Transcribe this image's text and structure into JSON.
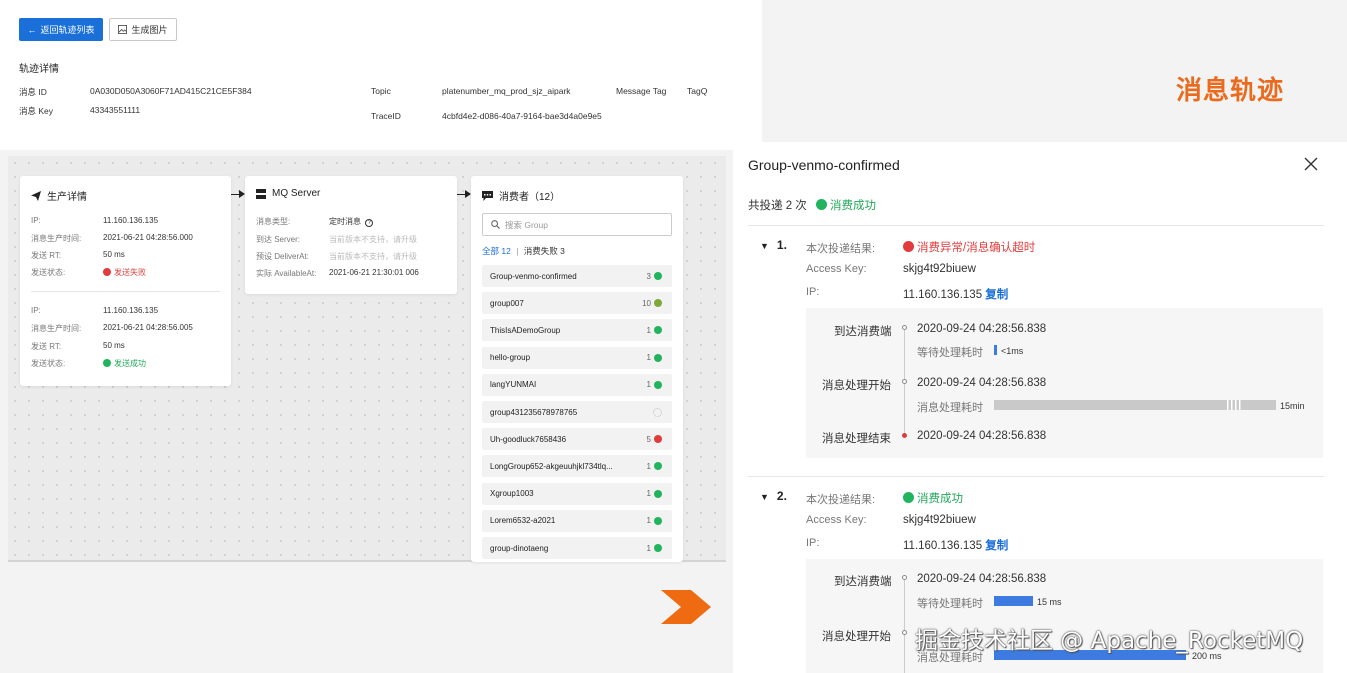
{
  "toolbar": {
    "back_label": "返回轨迹列表",
    "image_label": "生成图片"
  },
  "trace_info": {
    "section_title": "轨迹详情",
    "msg_id_label": "消息 ID",
    "msg_id": "0A030D050A3060F71AD415C21CE5F384",
    "msg_key_label": "消息 Key",
    "msg_key": "43343551111",
    "topic_label": "Topic",
    "topic": "platenumber_mq_prod_sjz_aipark",
    "tag_label": "Message Tag",
    "tag": "TagQ",
    "trace_id_label": "TraceID",
    "trace_id": "4cbfd4e2-d086-40a7-9164-bae3d4a0e9e5"
  },
  "slide_title": "消息轨迹",
  "producer": {
    "title": "生产详情",
    "records": [
      {
        "ip_label": "IP:",
        "ip": "11.160.136.135",
        "time_label": "消息生产时间:",
        "time": "2021-06-21 04:28:56.000",
        "rt_label": "发送 RT:",
        "rt": "50 ms",
        "status_label": "发送状态:",
        "status": "发送失败",
        "status_type": "fail"
      },
      {
        "ip_label": "IP:",
        "ip": "11.160.136.135",
        "time_label": "消息生产时间:",
        "time": "2021-06-21 04:28:56.005",
        "rt_label": "发送 RT:",
        "rt": "50 ms",
        "status_label": "发送状态:",
        "status": "发送成功",
        "status_type": "ok"
      }
    ]
  },
  "server": {
    "title": "MQ Server",
    "type_label": "消息类型:",
    "type": "定时消息",
    "arrive_label": "到达 Server:",
    "arrive": "当前版本不支持，请升级",
    "preset_label": "预设 DeliverAt:",
    "preset": "当前版本不支持，请升级",
    "actual_label": "实际 AvailableAt:",
    "actual": "2021-06-21 21:30:01 006"
  },
  "consumers": {
    "title": "消费者（12）",
    "search_placeholder": "搜索 Group",
    "filter_all": "全部 12",
    "filter_sep": "|",
    "filter_fail": "消费失败 3",
    "groups": [
      {
        "name": "Group-venmo-confirmed",
        "count": "3",
        "status": "ok"
      },
      {
        "name": "group007",
        "count": "10",
        "status": "partial"
      },
      {
        "name": "ThisIsADemoGroup",
        "count": "1",
        "status": "ok"
      },
      {
        "name": "hello-group",
        "count": "1",
        "status": "ok"
      },
      {
        "name": "langYUNMAI",
        "count": "1",
        "status": "ok"
      },
      {
        "name": "group431235678978765",
        "count": "",
        "status": "loading"
      },
      {
        "name": "Uh-goodluck7658436",
        "count": "5",
        "status": "fail"
      },
      {
        "name": "LongGroup652-akgeuuhjkl734tlq...",
        "count": "1",
        "status": "ok"
      },
      {
        "name": "Xgroup1003",
        "count": "1",
        "status": "ok"
      },
      {
        "name": "Lorem6532-a2021",
        "count": "1",
        "status": "ok"
      },
      {
        "name": "group-dinotaeng",
        "count": "1",
        "status": "ok"
      }
    ]
  },
  "detail": {
    "title": "Group-venmo-confirmed",
    "summary_prefix": "共投递 2 次",
    "summary_status": "消费成功",
    "attempts": [
      {
        "index": "1.",
        "result_label": "本次投递结果:",
        "result": "消费异常/消息确认超时",
        "result_type": "fail",
        "ak_label": "Access Key:",
        "ak": "skjg4t92biuew",
        "ip_label": "IP:",
        "ip": "11.160.136.135",
        "copy_label": "复制",
        "events": [
          {
            "label": "到达消费端",
            "time": "2020-09-24 04:28:56.838",
            "sub_label": "等待处理耗时",
            "sub_value": "<1ms",
            "bar_fraction": 0.01
          },
          {
            "label": "消息处理开始",
            "time": "2020-09-24 04:28:56.838",
            "sub_label": "消息处理耗时",
            "sub_value": "15min",
            "bar_fraction": 1.0
          },
          {
            "label": "消息处理结束",
            "time": "2020-09-24 04:28:56.838"
          }
        ]
      },
      {
        "index": "2.",
        "result_label": "本次投递结果:",
        "result": "消费成功",
        "result_type": "ok",
        "ak_label": "Access Key:",
        "ak": "skjg4t92biuew",
        "ip_label": "IP:",
        "ip": "11.160.136.135",
        "copy_label": "复制",
        "events": [
          {
            "label": "到达消费端",
            "time": "2020-09-24 04:28:56.838",
            "sub_label": "等待处理耗时",
            "sub_value": "15 ms",
            "bar_fraction": 0.07
          },
          {
            "label": "消息处理开始",
            "time": "",
            "sub_label": "消息处理耗时",
            "sub_value": "200 ms",
            "bar_fraction": 0.68
          }
        ]
      }
    ]
  },
  "watermark": "掘金技术社区 @ Apache_RocketMQ",
  "colors": {
    "primary": "#1a6fd8",
    "success": "#22b35e",
    "danger": "#e23b3b",
    "accent": "#ea6a1e"
  }
}
